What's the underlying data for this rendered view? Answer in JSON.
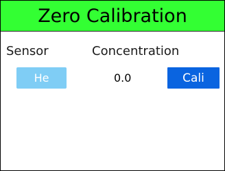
{
  "header": {
    "title": "Zero Calibration"
  },
  "columns": {
    "sensor_label": "Sensor",
    "concentration_label": "Concentration"
  },
  "row": {
    "sensor_button_label": "He",
    "concentration_value": "0.0",
    "calibrate_button_label": "Cali"
  },
  "colors": {
    "header_background": "#33ff33",
    "sensor_button": "#7fcdf5",
    "calibrate_button": "#0a64e0"
  }
}
